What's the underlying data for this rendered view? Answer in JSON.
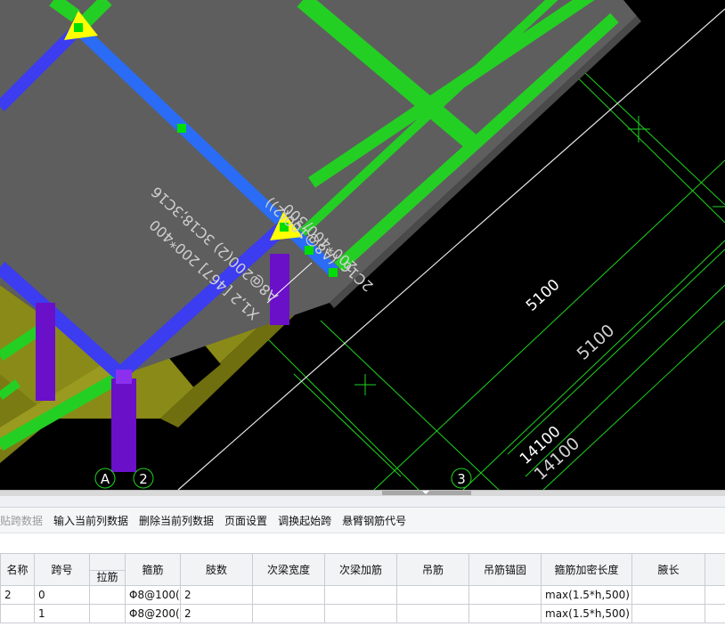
{
  "viewport": {
    "grid_labels": [
      {
        "id": "axis-A",
        "text": "A"
      },
      {
        "id": "axis-2",
        "text": "2"
      },
      {
        "id": "axis-3",
        "text": "3"
      }
    ],
    "beam_annotation": {
      "line1": "X1,2 [467] 200*400",
      "line2": "A8@200(2) 3C18;3C16"
    },
    "secondary_annotation": {
      "line1": "2C16",
      "line2": "200*400/300",
      "line3": "(A8@100(2))"
    },
    "dimensions": {
      "d1": "5100",
      "d2": "5100",
      "d3": "14100",
      "d4": "14100"
    },
    "colors": {
      "background": "#000000",
      "slab": "#606060",
      "beam_green": "#22cc22",
      "beam_blue": "#2a6cf5",
      "beam_dark_blue": "#3a3ae0",
      "column_purple": "#6a10c8",
      "marker_yellow": "#ffff00",
      "grid_line": "#00ff00"
    }
  },
  "toolbar": {
    "items": [
      {
        "name": "paste-span-data",
        "label": "贴跨数据",
        "enabled": false
      },
      {
        "name": "input-current-column-data",
        "label": "输入当前列数据",
        "enabled": true
      },
      {
        "name": "delete-current-column-data",
        "label": "删除当前列数据",
        "enabled": true
      },
      {
        "name": "page-settings",
        "label": "页面设置",
        "enabled": true
      },
      {
        "name": "swap-start-span",
        "label": "调换起始跨",
        "enabled": true
      },
      {
        "name": "cantilever-rebar-code",
        "label": "悬臂钢筋代号",
        "enabled": true
      }
    ]
  },
  "table": {
    "headers": {
      "name": "名称",
      "span_no": "跨号",
      "tie_bar": "拉筋",
      "stirrup": "箍筋",
      "legs": "肢数",
      "secondary_beam_width": "次梁宽度",
      "secondary_beam_rebar": "次梁加筋",
      "hanger_bar": "吊筋",
      "hanger_anchorage": "吊筋锚固",
      "stirrup_densify_length": "箍筋加密长度",
      "web_length": "腋长"
    },
    "rows": [
      {
        "name": "2",
        "span_no": "0",
        "tie_bar": "",
        "stirrup": "Φ8@100(",
        "legs": "2",
        "secondary_beam_width": "",
        "secondary_beam_rebar": "",
        "hanger_bar": "",
        "hanger_anchorage": "",
        "stirrup_densify_length": "max(1.5*h,500)",
        "web_length": ""
      },
      {
        "name": "",
        "span_no": "1",
        "tie_bar": "",
        "stirrup": "Φ8@200(",
        "legs": "2",
        "secondary_beam_width": "",
        "secondary_beam_rebar": "",
        "hanger_bar": "",
        "hanger_anchorage": "",
        "stirrup_densify_length": "max(1.5*h,500)",
        "web_length": ""
      }
    ]
  }
}
